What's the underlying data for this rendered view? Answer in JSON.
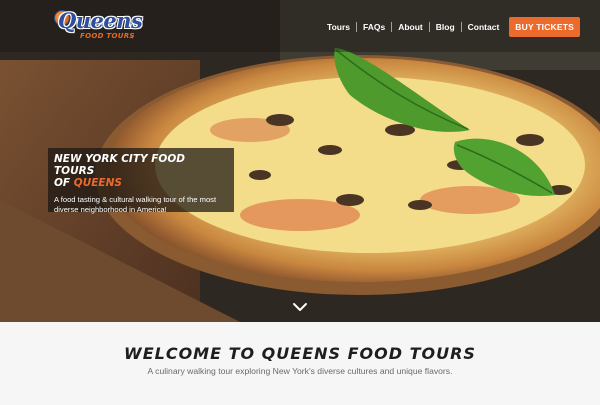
{
  "brand": {
    "name": "Queens",
    "tagline": "FOOD TOURS"
  },
  "nav": {
    "items": [
      {
        "label": "Tours"
      },
      {
        "label": "FAQs"
      },
      {
        "label": "About"
      },
      {
        "label": "Blog"
      },
      {
        "label": "Contact"
      }
    ],
    "cta_label": "BUY TICKETS"
  },
  "hero": {
    "heading_line1": "NEW YORK CITY FOOD TOURS",
    "heading_of": "OF",
    "heading_accent": "QUEENS",
    "description": "A food tasting & cultural walking tour of the most diverse neighborhood in America!"
  },
  "welcome": {
    "title": "WELCOME TO QUEENS FOOD TOURS",
    "subtitle": "A culinary walking tour exploring New York's diverse cultures and unique flavors."
  },
  "colors": {
    "accent": "#ec6a2c",
    "logo_blue": "#2d4f9e"
  },
  "icons": {
    "scroll_down": "chevron-down-icon",
    "logo_globe": "globe-icon",
    "logo_fork": "fork-icon"
  }
}
